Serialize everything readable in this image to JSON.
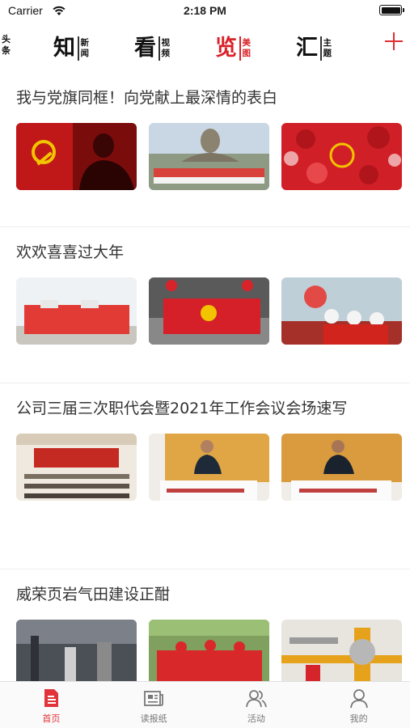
{
  "status_bar": {
    "carrier": "Carrier",
    "time": "2:18 PM"
  },
  "categories": {
    "first": {
      "line1": "头",
      "line2": "条"
    },
    "items": [
      {
        "big": "知",
        "small1": "新",
        "small2": "闻"
      },
      {
        "big": "看",
        "small1": "视",
        "small2": "频"
      },
      {
        "big": "览",
        "small1": "美",
        "small2": "图"
      },
      {
        "big": "汇",
        "small1": "主",
        "small2": "题"
      }
    ],
    "active_index": 2,
    "add_icon": "plus-icon"
  },
  "feed": {
    "articles": [
      {
        "title": "我与党旗同框！向党献上最深情的表白"
      },
      {
        "title": "欢欢喜喜过大年"
      },
      {
        "title": "公司三届三次职代会暨2021年工作会议会场速写"
      },
      {
        "title": "威荣页岩气田建设正酣"
      }
    ]
  },
  "bottom_tabs": [
    {
      "label": "首页",
      "icon": "home-doc-icon",
      "active": true
    },
    {
      "label": "读报纸",
      "icon": "newspaper-icon",
      "active": false
    },
    {
      "label": "活动",
      "icon": "people-icon",
      "active": false
    },
    {
      "label": "我的",
      "icon": "person-icon",
      "active": false
    }
  ],
  "colors": {
    "accent": "#e0333a",
    "divider": "#eeeeee",
    "tab_bar_bg": "#fafafa"
  }
}
